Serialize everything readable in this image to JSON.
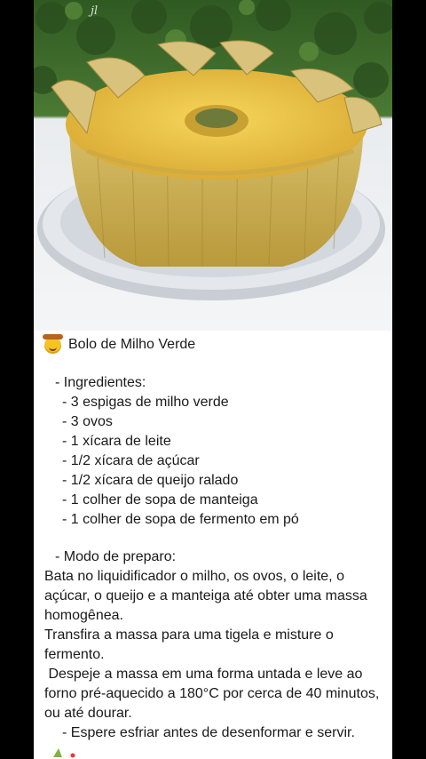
{
  "photo": {
    "watermark": "jl",
    "icon": "corn-cake-photo"
  },
  "recipe": {
    "emoji": "cowboy-face-emoji",
    "title": "Bolo de Milho Verde",
    "ingredients_heading": "- Ingredientes:",
    "ingredients": [
      "- 3 espigas de milho verde",
      "- 3 ovos",
      "- 1 xícara de leite",
      "- 1/2 xícara de açúcar",
      "- 1/2 xícara de queijo ralado",
      "- 1 colher de sopa de manteiga",
      "- 1 colher de sopa de fermento em pó"
    ],
    "method_heading": "- Modo de preparo:",
    "steps": [
      "Bata no liquidificador o milho, os ovos, o leite, o açúcar, o queijo e a manteiga até obter uma massa homogênea.",
      "Transfira a massa para uma tigela e misture o fermento.",
      " Despeje a massa em uma forma untada e leve ao forno pré-aquecido a 180°C por cerca de 40 minutos, ou até dourar."
    ],
    "final_step": "- Espere esfriar antes de desenformar e servir."
  },
  "colors": {
    "background": "#000000",
    "card": "#ffffff",
    "cake": "#e8c54a",
    "husk": "#c9b06a",
    "plate": "#dfe3e8",
    "foliage": "#3f6b2d"
  }
}
